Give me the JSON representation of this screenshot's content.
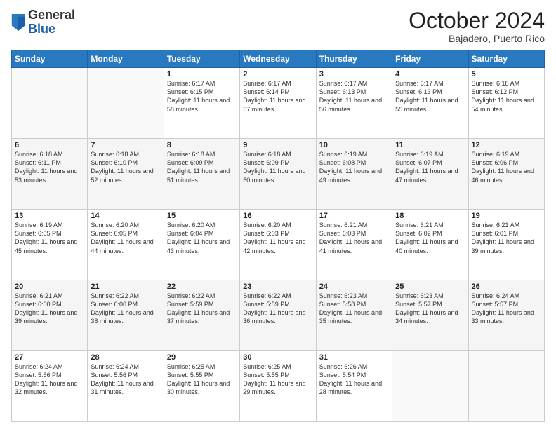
{
  "header": {
    "logo_general": "General",
    "logo_blue": "Blue",
    "month_title": "October 2024",
    "subtitle": "Bajadero, Puerto Rico"
  },
  "weekdays": [
    "Sunday",
    "Monday",
    "Tuesday",
    "Wednesday",
    "Thursday",
    "Friday",
    "Saturday"
  ],
  "weeks": [
    [
      {
        "day": "",
        "info": ""
      },
      {
        "day": "",
        "info": ""
      },
      {
        "day": "1",
        "info": "Sunrise: 6:17 AM\nSunset: 6:15 PM\nDaylight: 11 hours and 58 minutes."
      },
      {
        "day": "2",
        "info": "Sunrise: 6:17 AM\nSunset: 6:14 PM\nDaylight: 11 hours and 57 minutes."
      },
      {
        "day": "3",
        "info": "Sunrise: 6:17 AM\nSunset: 6:13 PM\nDaylight: 11 hours and 56 minutes."
      },
      {
        "day": "4",
        "info": "Sunrise: 6:17 AM\nSunset: 6:13 PM\nDaylight: 11 hours and 55 minutes."
      },
      {
        "day": "5",
        "info": "Sunrise: 6:18 AM\nSunset: 6:12 PM\nDaylight: 11 hours and 54 minutes."
      }
    ],
    [
      {
        "day": "6",
        "info": "Sunrise: 6:18 AM\nSunset: 6:11 PM\nDaylight: 11 hours and 53 minutes."
      },
      {
        "day": "7",
        "info": "Sunrise: 6:18 AM\nSunset: 6:10 PM\nDaylight: 11 hours and 52 minutes."
      },
      {
        "day": "8",
        "info": "Sunrise: 6:18 AM\nSunset: 6:09 PM\nDaylight: 11 hours and 51 minutes."
      },
      {
        "day": "9",
        "info": "Sunrise: 6:18 AM\nSunset: 6:09 PM\nDaylight: 11 hours and 50 minutes."
      },
      {
        "day": "10",
        "info": "Sunrise: 6:19 AM\nSunset: 6:08 PM\nDaylight: 11 hours and 49 minutes."
      },
      {
        "day": "11",
        "info": "Sunrise: 6:19 AM\nSunset: 6:07 PM\nDaylight: 11 hours and 47 minutes."
      },
      {
        "day": "12",
        "info": "Sunrise: 6:19 AM\nSunset: 6:06 PM\nDaylight: 11 hours and 46 minutes."
      }
    ],
    [
      {
        "day": "13",
        "info": "Sunrise: 6:19 AM\nSunset: 6:05 PM\nDaylight: 11 hours and 45 minutes."
      },
      {
        "day": "14",
        "info": "Sunrise: 6:20 AM\nSunset: 6:05 PM\nDaylight: 11 hours and 44 minutes."
      },
      {
        "day": "15",
        "info": "Sunrise: 6:20 AM\nSunset: 6:04 PM\nDaylight: 11 hours and 43 minutes."
      },
      {
        "day": "16",
        "info": "Sunrise: 6:20 AM\nSunset: 6:03 PM\nDaylight: 11 hours and 42 minutes."
      },
      {
        "day": "17",
        "info": "Sunrise: 6:21 AM\nSunset: 6:03 PM\nDaylight: 11 hours and 41 minutes."
      },
      {
        "day": "18",
        "info": "Sunrise: 6:21 AM\nSunset: 6:02 PM\nDaylight: 11 hours and 40 minutes."
      },
      {
        "day": "19",
        "info": "Sunrise: 6:21 AM\nSunset: 6:01 PM\nDaylight: 11 hours and 39 minutes."
      }
    ],
    [
      {
        "day": "20",
        "info": "Sunrise: 6:21 AM\nSunset: 6:00 PM\nDaylight: 11 hours and 39 minutes."
      },
      {
        "day": "21",
        "info": "Sunrise: 6:22 AM\nSunset: 6:00 PM\nDaylight: 11 hours and 38 minutes."
      },
      {
        "day": "22",
        "info": "Sunrise: 6:22 AM\nSunset: 5:59 PM\nDaylight: 11 hours and 37 minutes."
      },
      {
        "day": "23",
        "info": "Sunrise: 6:22 AM\nSunset: 5:59 PM\nDaylight: 11 hours and 36 minutes."
      },
      {
        "day": "24",
        "info": "Sunrise: 6:23 AM\nSunset: 5:58 PM\nDaylight: 11 hours and 35 minutes."
      },
      {
        "day": "25",
        "info": "Sunrise: 6:23 AM\nSunset: 5:57 PM\nDaylight: 11 hours and 34 minutes."
      },
      {
        "day": "26",
        "info": "Sunrise: 6:24 AM\nSunset: 5:57 PM\nDaylight: 11 hours and 33 minutes."
      }
    ],
    [
      {
        "day": "27",
        "info": "Sunrise: 6:24 AM\nSunset: 5:56 PM\nDaylight: 11 hours and 32 minutes."
      },
      {
        "day": "28",
        "info": "Sunrise: 6:24 AM\nSunset: 5:56 PM\nDaylight: 11 hours and 31 minutes."
      },
      {
        "day": "29",
        "info": "Sunrise: 6:25 AM\nSunset: 5:55 PM\nDaylight: 11 hours and 30 minutes."
      },
      {
        "day": "30",
        "info": "Sunrise: 6:25 AM\nSunset: 5:55 PM\nDaylight: 11 hours and 29 minutes."
      },
      {
        "day": "31",
        "info": "Sunrise: 6:26 AM\nSunset: 5:54 PM\nDaylight: 11 hours and 28 minutes."
      },
      {
        "day": "",
        "info": ""
      },
      {
        "day": "",
        "info": ""
      }
    ]
  ]
}
